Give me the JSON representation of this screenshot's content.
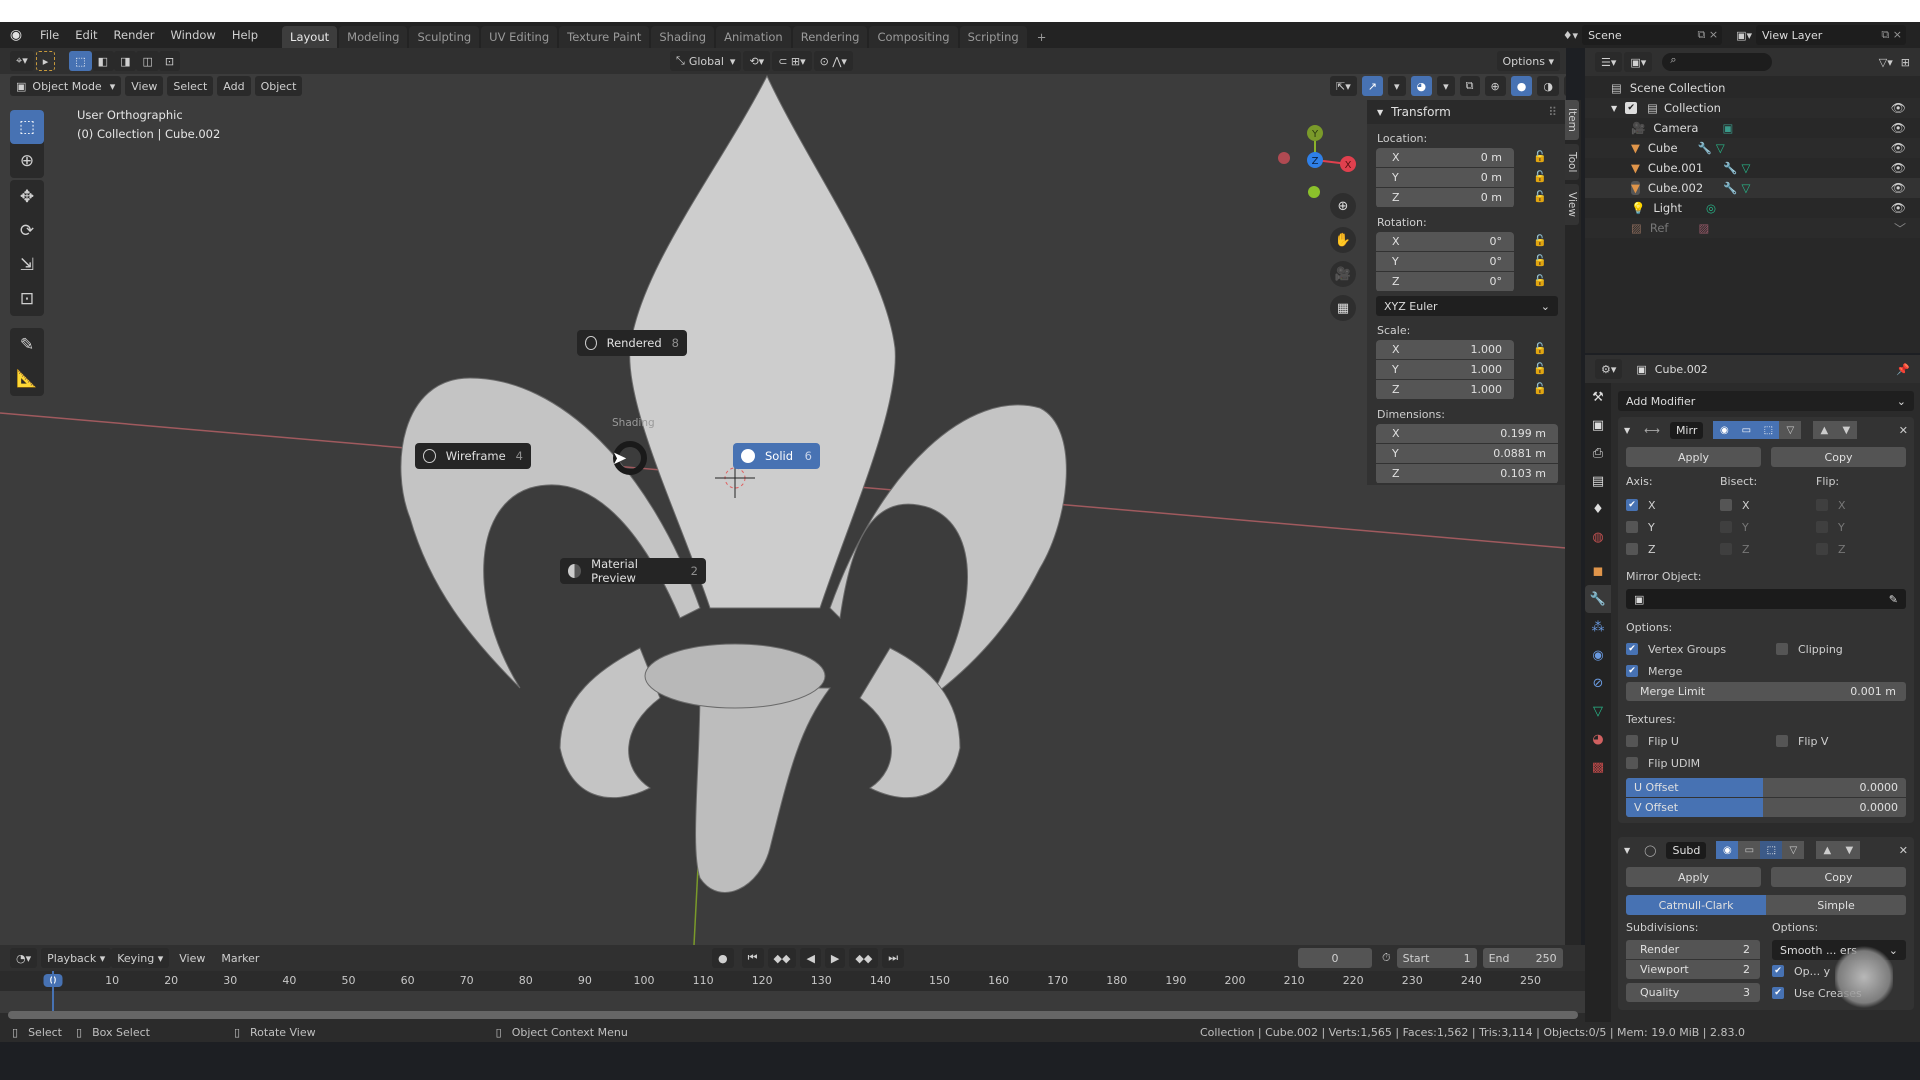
{
  "topbar": {
    "menus": [
      "File",
      "Edit",
      "Render",
      "Window",
      "Help"
    ],
    "workspaces": [
      {
        "label": "Layout",
        "active": true
      },
      {
        "label": "Modeling"
      },
      {
        "label": "Sculpting"
      },
      {
        "label": "UV Editing"
      },
      {
        "label": "Texture Paint"
      },
      {
        "label": "Shading"
      },
      {
        "label": "Animation"
      },
      {
        "label": "Rendering"
      },
      {
        "label": "Compositing"
      },
      {
        "label": "Scripting"
      }
    ],
    "add_workspace": "+",
    "scene": "Scene",
    "view_layer": "View Layer"
  },
  "tool_header": {
    "orientation": "Global",
    "options": "Options"
  },
  "viewport_header": {
    "mode": "Object Mode",
    "menus": [
      "View",
      "Select",
      "Add",
      "Object"
    ]
  },
  "viewport": {
    "view_name": "User Orthographic",
    "context": "(0) Collection | Cube.002",
    "pie_menu": {
      "title": "Shading",
      "items": [
        {
          "label": "Rendered",
          "key": "8",
          "icon": "rendered-icon"
        },
        {
          "label": "Wireframe",
          "key": "4",
          "icon": "wireframe-icon"
        },
        {
          "label": "Solid",
          "key": "6",
          "icon": "solid-icon",
          "selected": true
        },
        {
          "label": "Material Preview",
          "key": "2",
          "icon": "material-preview-icon"
        }
      ]
    },
    "gizmo": {
      "x": "X",
      "y": "Y",
      "z": "Z"
    }
  },
  "npanel": {
    "title": "Transform",
    "tabs": [
      "Item",
      "Tool",
      "View"
    ],
    "location": {
      "label": "Location:",
      "x": "0 m",
      "y": "0 m",
      "z": "0 m"
    },
    "rotation": {
      "label": "Rotation:",
      "x": "0°",
      "y": "0°",
      "z": "0°",
      "mode": "XYZ Euler"
    },
    "scale": {
      "label": "Scale:",
      "x": "1.000",
      "y": "1.000",
      "z": "1.000"
    },
    "dimensions": {
      "label": "Dimensions:",
      "x": "0.199 m",
      "y": "0.0881 m",
      "z": "0.103 m"
    },
    "axes": [
      "X",
      "Y",
      "Z"
    ]
  },
  "outliner": {
    "root": "Scene Collection",
    "items": [
      {
        "label": "Collection",
        "level": 0
      },
      {
        "label": "Camera",
        "level": 1
      },
      {
        "label": "Cube",
        "level": 1
      },
      {
        "label": "Cube.001",
        "level": 1
      },
      {
        "label": "Cube.002",
        "level": 1,
        "active": true
      },
      {
        "label": "Light",
        "level": 1
      },
      {
        "label": "Ref",
        "level": 1,
        "dim": true
      }
    ]
  },
  "properties": {
    "object": "Cube.002",
    "add_modifier": "Add Modifier",
    "mirror": {
      "name": "Mirr",
      "apply": "Apply",
      "copy": "Copy",
      "axis_label": "Axis:",
      "bisect_label": "Bisect:",
      "flip_label": "Flip:",
      "axis": {
        "X": true,
        "Y": false,
        "Z": false
      },
      "bisect": {
        "X": false,
        "Y": false,
        "Z": false
      },
      "flip": {
        "X": false,
        "Y": false,
        "Z": false
      },
      "mirror_object_label": "Mirror Object:",
      "options_label": "Options:",
      "vertex_groups": {
        "label": "Vertex Groups",
        "checked": true
      },
      "clipping": {
        "label": "Clipping",
        "checked": false
      },
      "merge": {
        "label": "Merge",
        "checked": true
      },
      "merge_limit": {
        "label": "Merge Limit",
        "value": "0.001 m"
      },
      "textures_label": "Textures:",
      "flip_u": {
        "label": "Flip U",
        "checked": false
      },
      "flip_v": {
        "label": "Flip V",
        "checked": false
      },
      "flip_udim": {
        "label": "Flip UDIM",
        "checked": false
      },
      "u_offset": {
        "label": "U Offset",
        "value": "0.0000"
      },
      "v_offset": {
        "label": "V Offset",
        "value": "0.0000"
      }
    },
    "subsurf": {
      "name": "Subd",
      "apply": "Apply",
      "copy": "Copy",
      "types": [
        "Catmull-Clark",
        "Simple"
      ],
      "subdivisions_label": "Subdivisions:",
      "options_label": "Options:",
      "render": {
        "label": "Render",
        "value": "2"
      },
      "viewport": {
        "label": "Viewport",
        "value": "2"
      },
      "quality": {
        "label": "Quality",
        "value": "3"
      },
      "uv_smooth": "Smooth ... ers",
      "optimal_display": "Op... y",
      "use_creases": "Use Creases"
    }
  },
  "timeline": {
    "menus": [
      "Playback",
      "Keying",
      "View",
      "Marker"
    ],
    "current_frame": "0",
    "start_label": "Start",
    "start": "1",
    "end_label": "End",
    "end": "250",
    "ticks": [
      "0",
      "10",
      "20",
      "30",
      "40",
      "50",
      "60",
      "70",
      "80",
      "90",
      "100",
      "110",
      "120",
      "130",
      "140",
      "150",
      "160",
      "170",
      "180",
      "190",
      "200",
      "210",
      "220",
      "230",
      "240",
      "250"
    ]
  },
  "statusbar": {
    "hints": [
      {
        "label": "Select"
      },
      {
        "label": "Box Select"
      },
      {
        "label": "Rotate View"
      },
      {
        "label": "Object Context Menu"
      }
    ],
    "info": "Collection | Cube.002 | Verts:1,565 | Faces:1,562 | Tris:3,114 | Objects:0/5 | Mem: 19.0 MiB | 2.83.0"
  },
  "colors": {
    "accent": "#4772b3",
    "x_axis": "#e0404e",
    "y_axis": "#8bb22b",
    "z_axis": "#2f80e8"
  }
}
